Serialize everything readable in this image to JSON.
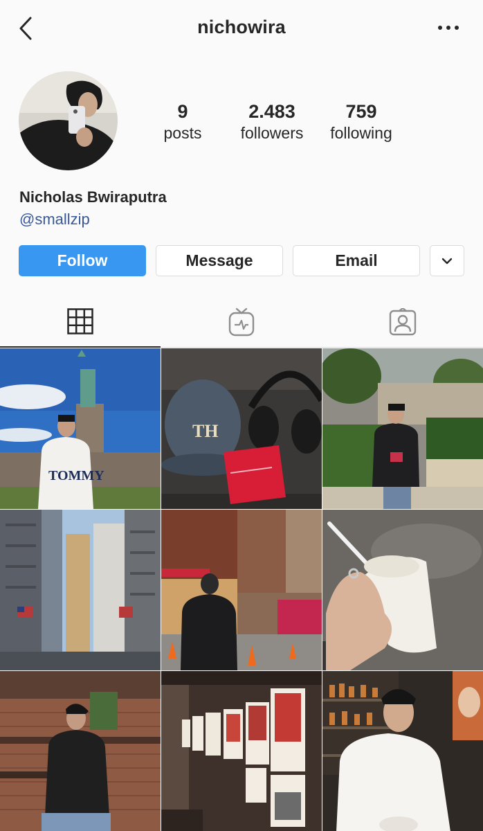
{
  "header": {
    "username": "nichowira",
    "back_icon": "chevron-left-icon",
    "more_icon": "more-horizontal-icon"
  },
  "profile": {
    "display_name": "Nicholas Bwiraputra",
    "handle": "@smallzip",
    "stats": {
      "posts": {
        "value": "9",
        "label": "posts"
      },
      "followers": {
        "value": "2.483",
        "label": "followers"
      },
      "following": {
        "value": "759",
        "label": "following"
      }
    }
  },
  "actions": {
    "follow": "Follow",
    "message": "Message",
    "email": "Email",
    "more_icon": "chevron-down-icon"
  },
  "tabs": [
    {
      "name": "grid",
      "icon": "grid-icon",
      "active": true
    },
    {
      "name": "igtv",
      "icon": "igtv-icon",
      "active": false
    },
    {
      "name": "tagged",
      "icon": "tagged-icon",
      "active": false
    }
  ],
  "posts": [
    {
      "subject": "statue-of-liberty"
    },
    {
      "subject": "cap-headphones-box"
    },
    {
      "subject": "garden-terrace"
    },
    {
      "subject": "city-skyscrapers"
    },
    {
      "subject": "street-traffic-cones"
    },
    {
      "subject": "coffee-cup-hand"
    },
    {
      "subject": "brick-wall-seated"
    },
    {
      "subject": "framed-posters-wall"
    },
    {
      "subject": "bar-shelf-portrait"
    }
  ],
  "colors": {
    "accent": "#3897f0",
    "handle_link": "#385898",
    "text": "#262626",
    "border": "#dbdbdb",
    "background": "#fafafa"
  }
}
